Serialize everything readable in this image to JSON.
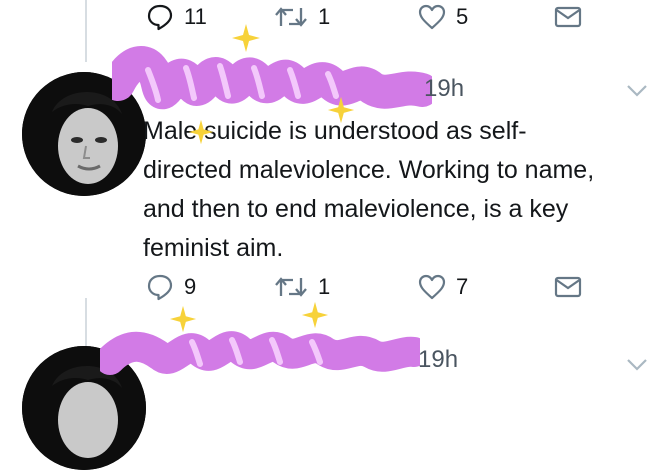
{
  "top_actions": {
    "reply_count": "11",
    "retweet_count": "1",
    "like_count": "5"
  },
  "tweet": {
    "time": "19h",
    "text": "Male suicide is understood as self-\ndirected maleviolence. Working to name,\nand then to end maleviolence, is a key\nfeminist aim.",
    "reply_count": "9",
    "retweet_count": "1",
    "like_count": "7"
  },
  "next_tweet": {
    "time": "19h"
  },
  "colors": {
    "icon": "#657786",
    "text": "#14171a",
    "censor_scribble": "#d27be6",
    "sparkle": "#f7d23a",
    "divider": "#d7dde2"
  },
  "icons": [
    "reply-icon",
    "retweet-icon",
    "like-icon",
    "message-icon",
    "caret-down-icon"
  ]
}
